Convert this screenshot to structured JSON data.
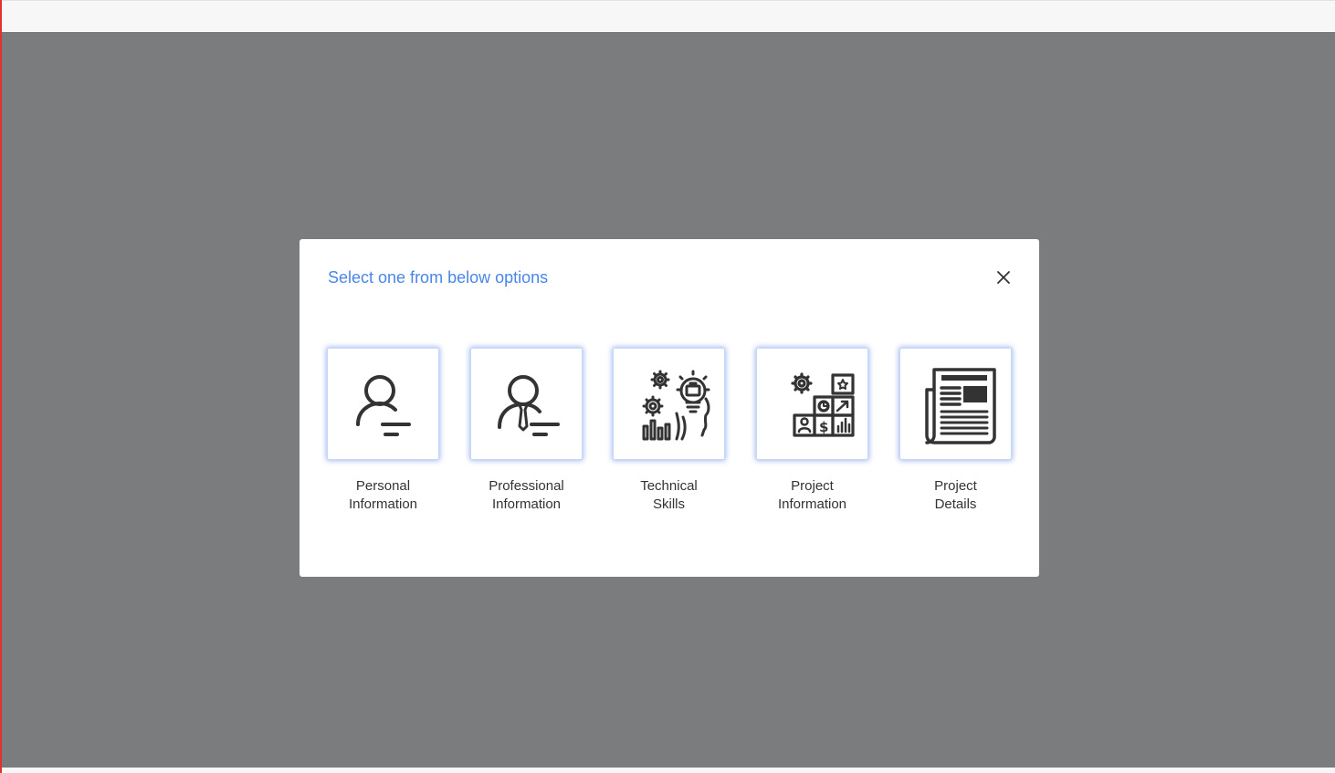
{
  "modal": {
    "title": "Select one from below options",
    "close_icon": "close-icon",
    "options": [
      {
        "line1": "Personal",
        "line2": "Information",
        "icon": "person-icon"
      },
      {
        "line1": "Professional",
        "line2": "Information",
        "icon": "professional-person-icon"
      },
      {
        "line1": "Technical",
        "line2": "Skills",
        "icon": "technical-skills-icon"
      },
      {
        "line1": "Project",
        "line2": "Information",
        "icon": "project-blocks-icon"
      },
      {
        "line1": "Project",
        "line2": "Details",
        "icon": "newspaper-icon"
      }
    ]
  },
  "colors": {
    "title": "#4a86e8",
    "overlay": "#7b7c7e",
    "icon_stroke": "#333333",
    "tile_glow": "#5a82eb"
  }
}
